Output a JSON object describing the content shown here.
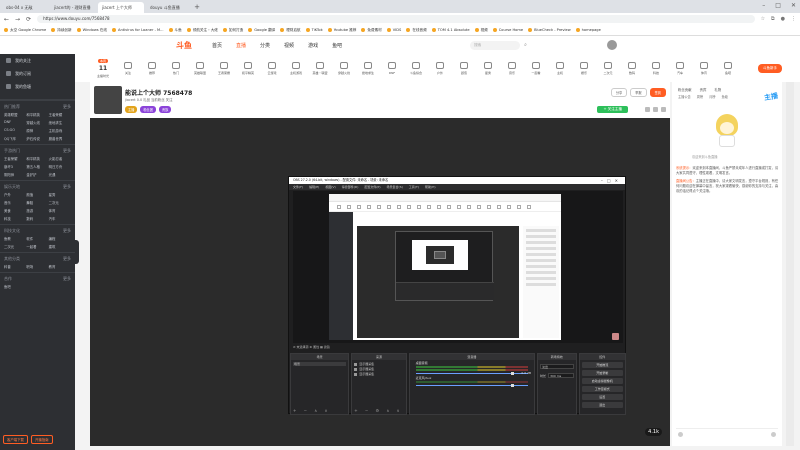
{
  "browser": {
    "tabs": [
      "obs-04 x 无敌",
      "jiacert的 - 理财直播",
      "jiacert 上个大师 ",
      "douyu 斗鱼直播"
    ],
    "url": "https://www.douyu.com/7568478",
    "bookmarks": [
      "太空 Google Chrome",
      "持续创新",
      "Windows 在线",
      "Antivirus for Loaner - M...",
      "斗鱼",
      "领航关注・大佬",
      "如何打造",
      "Google 翻译",
      "理财启航",
      "TiKTok",
      "Youtube 推荐",
      "免费素材",
      "VIDS",
      "在线音频",
      "TOM 4.1 Absolute",
      "视频",
      "Course Home",
      "BlueCheck - Preview",
      "homepage"
    ]
  },
  "site": {
    "logo": "斗鱼",
    "nav": [
      "首页",
      "直播",
      "分类",
      "视频",
      "游戏",
      "鱼吧"
    ],
    "search_placeholder": "搜索"
  },
  "sidebar": {
    "top_items": [
      "我的关注",
      "我的订阅",
      "我的鱼塘",
      "关注"
    ],
    "sections": [
      {
        "title": "热门推荐",
        "more": "更多",
        "items": [
          "英雄联盟",
          "和平精英",
          "王者荣耀",
          "DNF",
          "穿越火线",
          "绝地求生",
          "CS:GO",
          "原神",
          "主机游戏",
          "QQ飞车",
          "炉石传说",
          "魔兽世界"
        ]
      },
      {
        "title": "手游热门",
        "more": "更多",
        "items": [
          "王者荣耀",
          "和平精英",
          "火影忍者",
          "崩坏3",
          "第五人格",
          "明日方舟",
          "阴阳师",
          "金铲铲",
          "光遇"
        ]
      },
      {
        "title": "娱乐天地",
        "more": "更多",
        "items": [
          "户外",
          "颜值",
          "星秀",
          "音乐",
          "舞蹈",
          "二次元",
          "美食",
          "旅游",
          "体育",
          "科技",
          "数码",
          "汽车"
        ]
      },
      {
        "title": "科技文化",
        "more": "更多",
        "items": [
          "鱼教",
          "软件",
          "编程",
          "二次元",
          "一起看",
          "建筑"
        ]
      },
      {
        "title": "其他分类",
        "more": "更多",
        "items": [
          "科普",
          "职场",
          "教育"
        ]
      },
      {
        "title": "合作",
        "more": "更多",
        "items": [
          "鱼吧"
        ]
      }
    ],
    "bottom_buttons": [
      "客户端下载",
      "开播指南"
    ]
  },
  "categories": {
    "first": {
      "num": "11",
      "label": "主播时光",
      "badge": "本周"
    },
    "items": [
      "关注",
      "推荐",
      "热门",
      "英雄联盟",
      "王者荣耀",
      "和平精英",
      "云游戏",
      "主机游戏",
      "英雄・联盟",
      "穿越火线",
      "绝地求生",
      "DNF",
      "斗鱼综合",
      "户外",
      "颜值",
      "星秀",
      "音乐",
      "一起看",
      "主机",
      "娱乐",
      "二次元",
      "数码",
      "科技",
      "汽车",
      "体育",
      "鱼吧"
    ],
    "pill": "斗鱼新手"
  },
  "room": {
    "title": "能说上个大师",
    "room_id": "7568478",
    "sub": "jiacert 0.0  礼品   当前粉丝  关注",
    "tags": [
      "主播",
      "粉丝团",
      "贵族"
    ],
    "right_buttons": [
      "分享",
      "举报",
      "签到"
    ],
    "follow": "+ 关注主播"
  },
  "obs": {
    "title": "OBS 27.2.0 (64-bit, windows) - 配置文件: 未命名 - 场景: 未命名",
    "menu": [
      "文件(F)",
      "编辑(E)",
      "视图(V)",
      "停靠部件(D)",
      "配置文件(P)",
      "场景集合(S)",
      "工具(T)",
      "帮助(H)"
    ],
    "ctrl_row": "⊘  未选择源  ⚙ 属性  ▦ 滤镜",
    "docks": {
      "scenes": {
        "title": "场景",
        "items": [
          "场景"
        ]
      },
      "sources": {
        "title": "来源",
        "items": [
          "显示器采集",
          "显示器采集",
          "显示器采集"
        ]
      },
      "mixer": {
        "title": "混音器",
        "channels": [
          "桌面音频",
          "麦克风/Aux"
        ],
        "db": "0.0 dB"
      },
      "transitions": {
        "title": "转场特效",
        "fade": "淡出",
        "duration_label": "时长",
        "duration": "300 ms"
      },
      "controls": {
        "title": "控件",
        "buttons": [
          "开始推流",
          "开始录制",
          "启动虚拟摄像机",
          "工作室模式",
          "设置",
          "退出"
        ]
      }
    }
  },
  "player": {
    "float": "4.1k"
  },
  "chat": {
    "tabs": [
      "粉丝贡献",
      "贵宾",
      "礼物"
    ],
    "tabs2": [
      "主播公告",
      "周榜",
      "月榜",
      "鱼塘"
    ],
    "mascot_caption": "欢迎来到斗鱼直播",
    "banner": "主播",
    "messages": [
      {
        "user": "系统提示：",
        "body": "欢迎来到本直播间，斗鱼严禁未成年人进行直播或打赏，请大家共同遵守，理性观看，文明发言。"
      },
      {
        "user": "直播间公告：",
        "body": "主播正在直播中，请大家文明发言，遵守平台规则，有任何问题欢迎在弹幕中留言，祝大家观看愉快，感谢你的支持与关注，喜欢的话记得点个关注哦。"
      }
    ]
  },
  "colors": {
    "brand": "#ff5d23",
    "sidebar": "#2d2f33",
    "obs_bg": "#1f1f20",
    "follow": "#2dbf5a"
  }
}
